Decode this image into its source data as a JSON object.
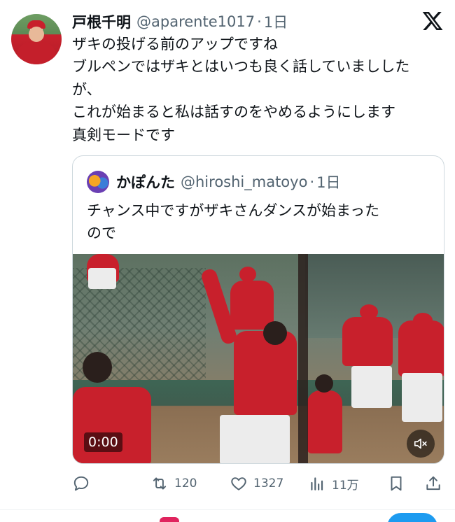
{
  "tweet": {
    "author_name": "戸根千明",
    "handle": "@aparente1017",
    "separator": "·",
    "time": "1日",
    "lines": [
      "ザキの投げる前のアップですね",
      "ブルペンではザキとはいつも良く話していましした",
      "が、",
      "これが始まると私は話すのをやめるようにします",
      "真剣モードです"
    ]
  },
  "quote": {
    "author_name": "かぽんた",
    "handle": "@hiroshi_matoyo",
    "separator": "·",
    "time": "1日",
    "lines": [
      "チャンス中ですがザキさんダンスが始まった",
      "ので"
    ],
    "video": {
      "time": "0:00",
      "muted": true
    }
  },
  "actions": {
    "reply_count": "",
    "retweet_count": "120",
    "like_count": "1327",
    "views_count": "11万"
  },
  "icons": {
    "brand": "x-logo-icon",
    "reply": "reply-icon",
    "retweet": "retweet-icon",
    "like": "heart-icon",
    "views": "views-icon",
    "bookmark": "bookmark-icon",
    "share": "share-icon",
    "mute": "mute-icon"
  },
  "colors": {
    "text": "#0f1419",
    "secondary": "#536471",
    "border": "#cfd9de",
    "accent": "#1d9bf0"
  }
}
